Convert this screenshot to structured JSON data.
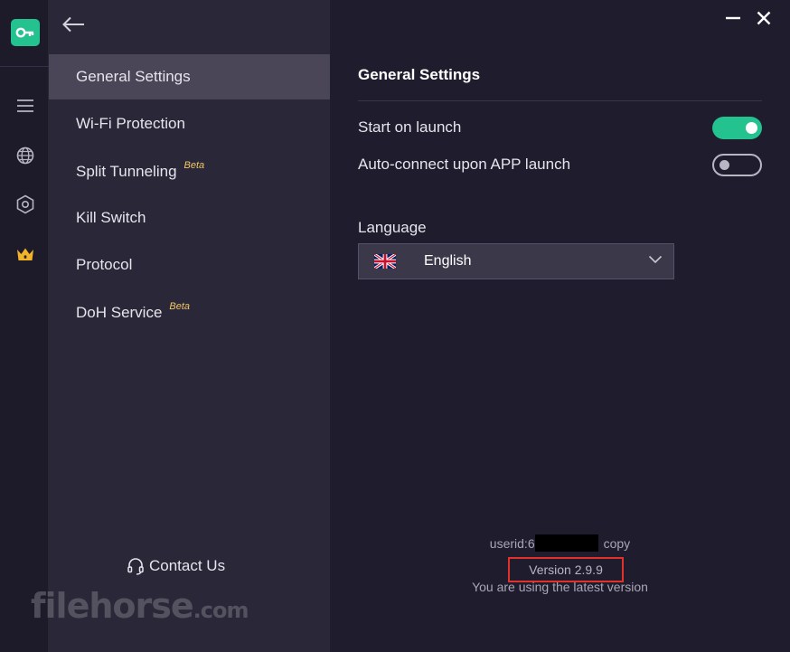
{
  "menu": {
    "items": [
      {
        "label": "General Settings",
        "beta": ""
      },
      {
        "label": "Wi-Fi Protection",
        "beta": ""
      },
      {
        "label": "Split Tunneling",
        "beta": "Beta"
      },
      {
        "label": "Kill Switch",
        "beta": ""
      },
      {
        "label": "Protocol",
        "beta": ""
      },
      {
        "label": "DoH Service",
        "beta": "Beta"
      }
    ],
    "contact_label": "Contact Us"
  },
  "watermark": {
    "main": "filehorse",
    "suffix": ".com"
  },
  "main": {
    "title": "General Settings",
    "settings": [
      {
        "label": "Start on launch",
        "enabled": true
      },
      {
        "label": "Auto-connect upon APP launch",
        "enabled": false
      }
    ],
    "language_label": "Language",
    "language_value": "English"
  },
  "footer": {
    "userid_prefix": "userid:6",
    "copy_label": "copy",
    "version": "Version 2.9.9",
    "status": "You are using the latest version"
  },
  "colors": {
    "accent": "#23c28f",
    "crown": "#f0b429",
    "beta": "#f0c867",
    "highlight_box": "#e0312b"
  },
  "icons": {
    "rail": [
      "vpn-key-icon",
      "menu-icon",
      "globe-icon",
      "hexagon-settings-icon",
      "crown-icon"
    ],
    "window": [
      "minimize-icon",
      "close-icon"
    ]
  }
}
